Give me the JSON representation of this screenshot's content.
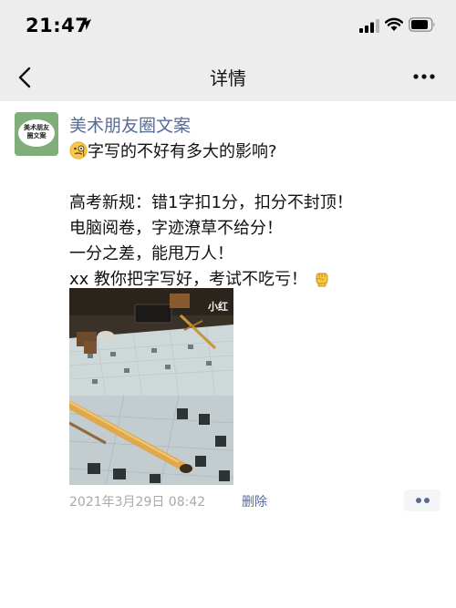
{
  "status_bar": {
    "time": "21:47",
    "icons": [
      "location-arrow-icon",
      "cellular-signal-icon",
      "wifi-icon",
      "battery-icon"
    ]
  },
  "nav": {
    "title": "详情",
    "back_icon": "chevron-left-icon",
    "more_icon": "more-dots-icon"
  },
  "post": {
    "avatar_text_line1": "美术朋友",
    "avatar_text_line2": "圈文案",
    "username": "美术朋友圈文案",
    "line1": "字写的不好有多大的影响?",
    "line2": "高考新规：错1字扣1分，扣分不封顶！",
    "line3": "电脑阅卷，字迹潦草不给分！",
    "line4": "一分之差，能甩万人！",
    "line5": "xx 教你把字写好，考试不吃亏！",
    "emoji_start": "face-with-monocle-emoji",
    "emoji_end": "raised-fist-emoji",
    "photo_watermark": "小红",
    "timestamp": "2021年3月29日 08:42",
    "delete_label": "删除",
    "comment_icon": "two-dots-icon"
  },
  "colors": {
    "link_blue": "#576b95",
    "nav_bg": "#ededed",
    "meta_gray": "#a9a9a9"
  }
}
